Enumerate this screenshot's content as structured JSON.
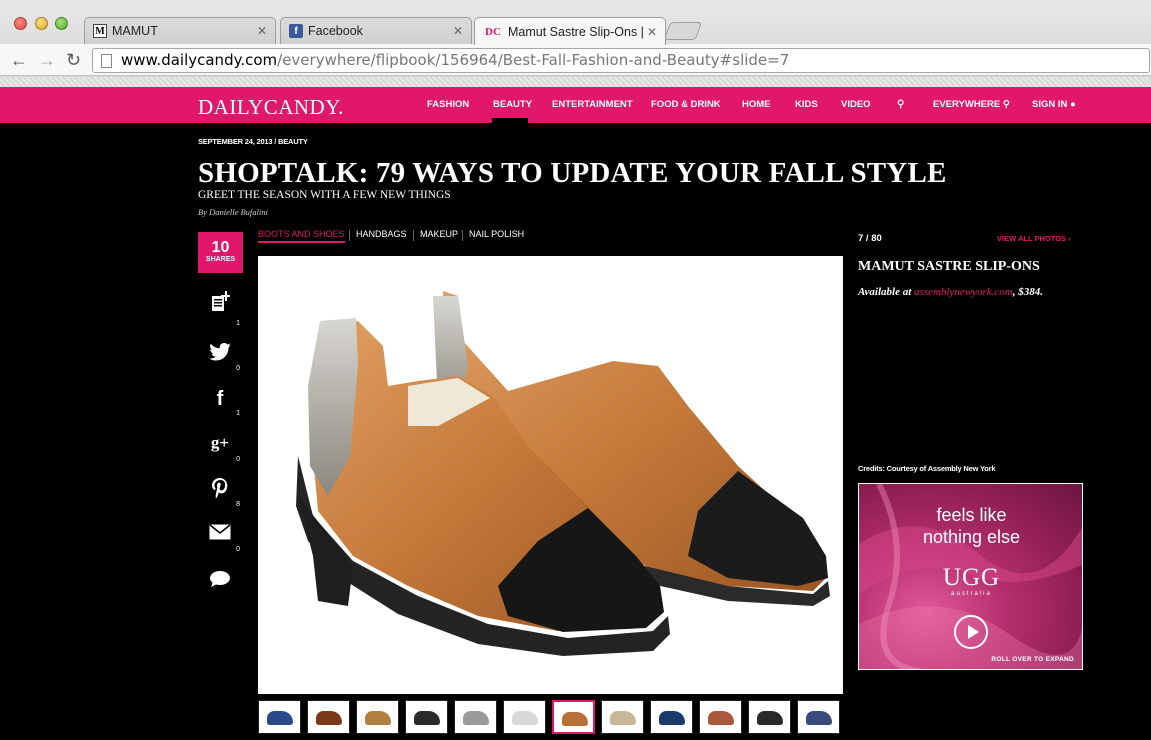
{
  "browser": {
    "tabs": [
      {
        "label": "MAMUT",
        "favicon": "M"
      },
      {
        "label": "Facebook",
        "favicon": "f"
      },
      {
        "label": "Mamut Sastre Slip-Ons | Be",
        "favicon": "DC"
      }
    ],
    "url_host": "www.dailycandy.com",
    "url_path": "/everywhere/flipbook/156964/Best-Fall-Fashion-and-Beauty#slide=7"
  },
  "site": {
    "logo": "DAILYCANDY.",
    "brand_color": "#e0176b",
    "nav": [
      {
        "label": "FASHION"
      },
      {
        "label": "BEAUTY"
      },
      {
        "label": "ENTERTAINMENT"
      },
      {
        "label": "FOOD & DRINK"
      },
      {
        "label": "HOME"
      },
      {
        "label": "KIDS"
      },
      {
        "label": "VIDEO"
      },
      {
        "label": "EVERYWHERE"
      },
      {
        "label": "SIGN IN"
      }
    ]
  },
  "article": {
    "date": "SEPTEMBER 24, 2013",
    "section": "BEAUTY",
    "headline": "SHOPTALK: 79 WAYS TO UPDATE YOUR FALL STYLE",
    "dek": "GREET THE SEASON WITH A FEW NEW THINGS",
    "byline_prefix": "By",
    "author": "Danielle Bufalini"
  },
  "share": {
    "count": "10",
    "label": "SHARES",
    "items": [
      {
        "icon": "clipboard-add-icon",
        "glyph": "✚",
        "count": "1"
      },
      {
        "icon": "twitter-icon",
        "glyph": "🐦",
        "count": "0"
      },
      {
        "icon": "facebook-icon",
        "glyph": "f",
        "count": "1"
      },
      {
        "icon": "google-plus-icon",
        "glyph": "g+",
        "count": "0"
      },
      {
        "icon": "pinterest-icon",
        "glyph": "P",
        "count": "8"
      },
      {
        "icon": "email-icon",
        "glyph": "✉",
        "count": "0"
      },
      {
        "icon": "comment-icon",
        "glyph": "💬",
        "count": ""
      }
    ]
  },
  "categories": [
    {
      "label": "BOOTS AND SHOES"
    },
    {
      "label": "HANDBAGS"
    },
    {
      "label": "MAKEUP"
    },
    {
      "label": "NAIL POLISH"
    }
  ],
  "slide": {
    "counter": "7 / 80",
    "view_all": "VIEW ALL PHOTOS",
    "title": "MAMUT SASTRE SLIP-ONS",
    "available_prefix": "Available at",
    "available_link": "assemblynewyork.com",
    "available_suffix": ", $384.",
    "credits": "Credits: Courtesy of Assembly New York"
  },
  "thumbnails": {
    "count": 12,
    "active_index": 6,
    "colors": [
      "#2a4a8a",
      "#7a3a1a",
      "#b08040",
      "#2a2a2a",
      "#999999",
      "#d8d8d8",
      "#b87038",
      "#c8b898",
      "#1a3a6a",
      "#a85a3a",
      "#2a2a2a",
      "#3a4a7a"
    ]
  },
  "ad": {
    "line1": "feels like",
    "line2": "nothing else",
    "brand": "UGG",
    "sub": "australia",
    "cta": "ROLL OVER TO EXPAND"
  }
}
